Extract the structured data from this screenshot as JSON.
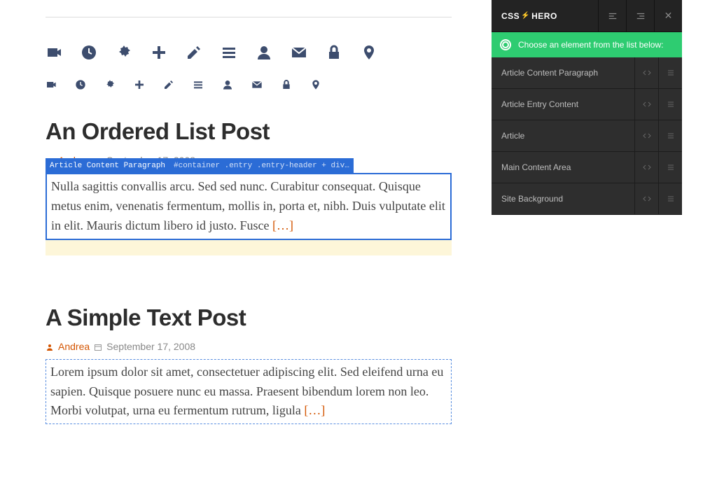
{
  "icons_large": [
    "video",
    "clock",
    "gear",
    "plus",
    "edit",
    "menu",
    "user",
    "mail",
    "lock",
    "pin"
  ],
  "icons_small": [
    "video",
    "clock",
    "gear",
    "plus",
    "edit",
    "menu",
    "user",
    "mail",
    "lock",
    "pin"
  ],
  "posts": {
    "first": {
      "title": "An Ordered List Post",
      "author": "Andrea",
      "date": "September 17, 2008",
      "excerpt": "Nulla sagittis convallis arcu. Sed sed nunc. Curabitur consequat. Quisque metus enim, venenatis fermentum, mollis in, porta et, nibh. Duis vulputate elit in elit. Mauris dictum libero id justo. Fusce ",
      "more": "[…]",
      "tooltip_label": "Article Content Paragraph",
      "tooltip_selector": "#container .entry .entry-header + div…"
    },
    "second": {
      "title": "A Simple Text Post",
      "author": "Andrea",
      "date": "September 17, 2008",
      "excerpt": "Lorem ipsum dolor sit amet, consectetuer adipiscing elit. Sed eleifend urna eu sapien. Quisque posuere nunc eu massa. Praesent bibendum lorem non leo. Morbi volutpat, urna eu fermentum rutrum, ligula ",
      "more": "[…]"
    }
  },
  "panel": {
    "logo_a": "CSS",
    "logo_b": "HERO",
    "bolt": "⚡",
    "close": "✕",
    "banner": "Choose an element from the list below:",
    "items": [
      {
        "label": "Article Content Paragraph"
      },
      {
        "label": "Article Entry Content"
      },
      {
        "label": "Article"
      },
      {
        "label": "Main Content Area"
      },
      {
        "label": "Site Background"
      }
    ]
  }
}
